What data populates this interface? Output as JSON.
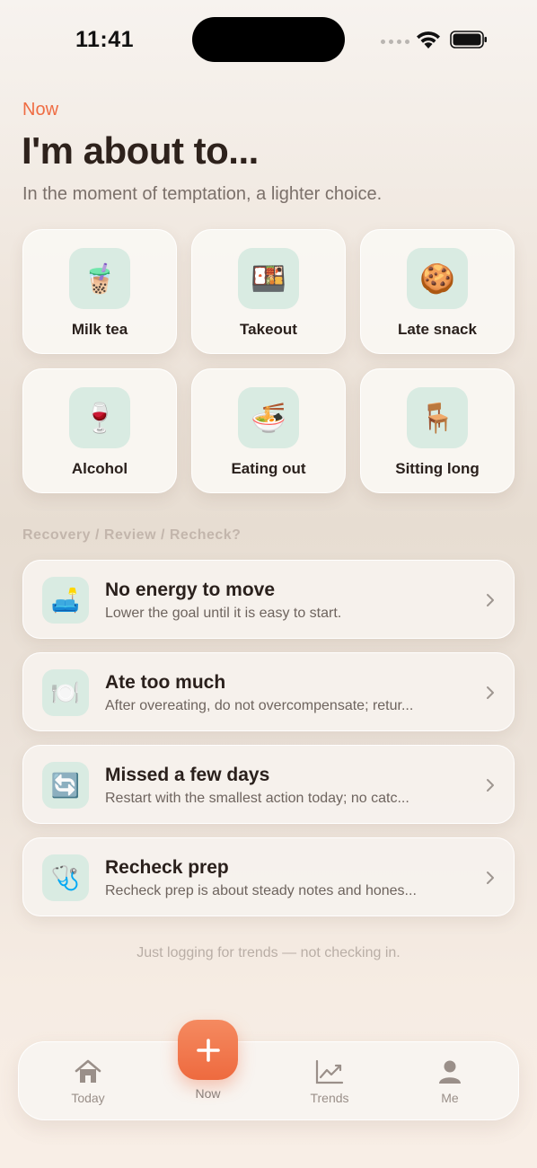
{
  "status_bar": {
    "time": "11:41"
  },
  "header": {
    "eyebrow": "Now",
    "title": "I'm about to...",
    "subtitle": "In the moment of temptation, a lighter choice."
  },
  "tiles": [
    {
      "label": "Milk tea",
      "icon": "bubble-tea-icon",
      "emoji": "🧋"
    },
    {
      "label": "Takeout",
      "icon": "bento-box-icon",
      "emoji": "🍱"
    },
    {
      "label": "Late snack",
      "icon": "cookie-icon",
      "emoji": "🍪"
    },
    {
      "label": "Alcohol",
      "icon": "wine-glass-icon",
      "emoji": "🍷"
    },
    {
      "label": "Eating out",
      "icon": "noodle-bowl-icon",
      "emoji": "🍜"
    },
    {
      "label": "Sitting long",
      "icon": "chair-icon",
      "emoji": "🪑"
    }
  ],
  "section_label": "Recovery / Review / Recheck?",
  "list": [
    {
      "title": "No energy to move",
      "desc": "Lower the goal until it is easy to start.",
      "icon": "couch-icon",
      "emoji": "🛋️"
    },
    {
      "title": "Ate too much",
      "desc": "After overeating, do not overcompensate; retur...",
      "icon": "plate-icon",
      "emoji": "🍽️"
    },
    {
      "title": "Missed a few days",
      "desc": "Restart with the smallest action today; no catc...",
      "icon": "restart-arrows-icon",
      "emoji": "🔄"
    },
    {
      "title": "Recheck prep",
      "desc": "Recheck prep is about steady notes and hones...",
      "icon": "stethoscope-icon",
      "emoji": "🩺"
    }
  ],
  "footnote": "Just logging for trends — not checking in.",
  "tabbar": {
    "today": "Today",
    "now": "Now",
    "trends": "Trends",
    "me": "Me"
  },
  "colors": {
    "accent": "#ef6c43",
    "icon_bg": "#d9ebe2"
  }
}
